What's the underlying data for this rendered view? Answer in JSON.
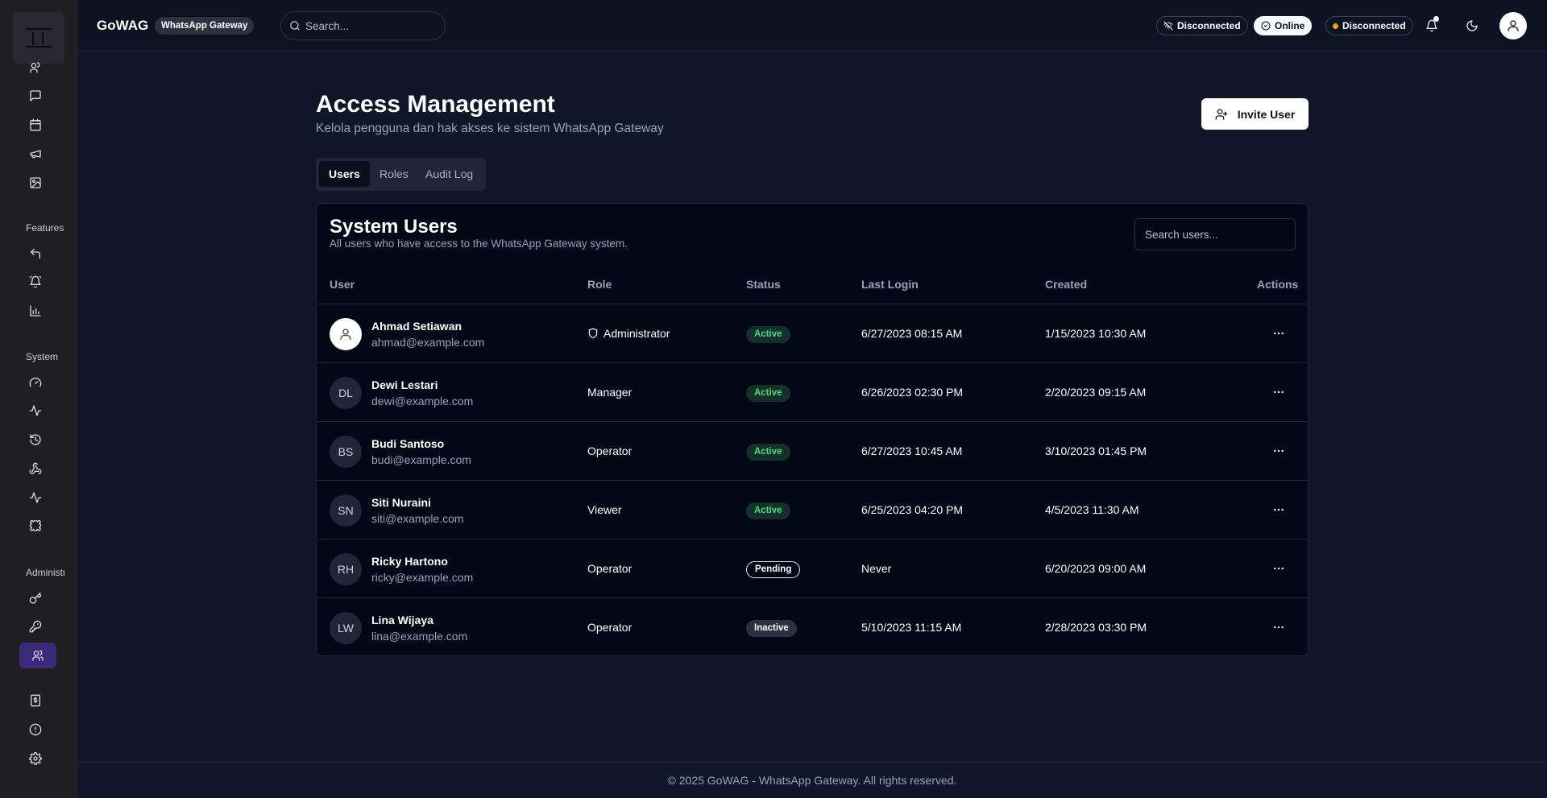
{
  "header": {
    "brand": "GoWAG",
    "brand_badge": "WhatsApp Gateway",
    "search_placeholder": "Search...",
    "status_disconnected_1": "Disconnected",
    "status_online": "Online",
    "status_disconnected_2": "Disconnected"
  },
  "sidebar": {
    "sections": {
      "features": "Features",
      "system": "System",
      "administration": "Administration"
    },
    "icons": [
      "contacts-icon",
      "chat-icon",
      "calendar-icon",
      "megaphone-icon",
      "image-icon",
      "reply-icon",
      "alarm-icon",
      "bar-chart-icon",
      "gauge-icon",
      "activity-icon",
      "history-icon",
      "webhook-icon",
      "pulse-icon",
      "puzzle-icon",
      "key-icon",
      "key-round-icon",
      "users-icon",
      "billing-icon",
      "info-icon",
      "settings-icon"
    ]
  },
  "page": {
    "title": "Access Management",
    "subtitle": "Kelola pengguna dan hak akses ke sistem WhatsApp Gateway",
    "invite_label": "Invite User",
    "tabs": [
      "Users",
      "Roles",
      "Audit Log"
    ]
  },
  "card": {
    "title": "System Users",
    "subtitle": "All users who have access to the WhatsApp Gateway system.",
    "search_placeholder": "Search users...",
    "columns": [
      "User",
      "Role",
      "Status",
      "Last Login",
      "Created",
      "Actions"
    ],
    "rows": [
      {
        "initials": "",
        "name": "Ahmad Setiawan",
        "email": "ahmad@example.com",
        "role": "Administrator",
        "status": "Active",
        "last_login": "6/27/2023 08:15 AM",
        "created": "1/15/2023 10:30 AM"
      },
      {
        "initials": "DL",
        "name": "Dewi Lestari",
        "email": "dewi@example.com",
        "role": "Manager",
        "status": "Active",
        "last_login": "6/26/2023 02:30 PM",
        "created": "2/20/2023 09:15 AM"
      },
      {
        "initials": "BS",
        "name": "Budi Santoso",
        "email": "budi@example.com",
        "role": "Operator",
        "status": "Active",
        "last_login": "6/27/2023 10:45 AM",
        "created": "3/10/2023 01:45 PM"
      },
      {
        "initials": "SN",
        "name": "Siti Nuraini",
        "email": "siti@example.com",
        "role": "Viewer",
        "status": "Active",
        "last_login": "6/25/2023 04:20 PM",
        "created": "4/5/2023 11:30 AM"
      },
      {
        "initials": "RH",
        "name": "Ricky Hartono",
        "email": "ricky@example.com",
        "role": "Operator",
        "status": "Pending",
        "last_login": "Never",
        "created": "6/20/2023 09:00 AM"
      },
      {
        "initials": "LW",
        "name": "Lina Wijaya",
        "email": "lina@example.com",
        "role": "Operator",
        "status": "Inactive",
        "last_login": "5/10/2023 11:15 AM",
        "created": "2/28/2023 03:30 PM"
      }
    ]
  },
  "footer": {
    "text": "© 2025 GoWAG - WhatsApp Gateway. All rights reserved."
  }
}
